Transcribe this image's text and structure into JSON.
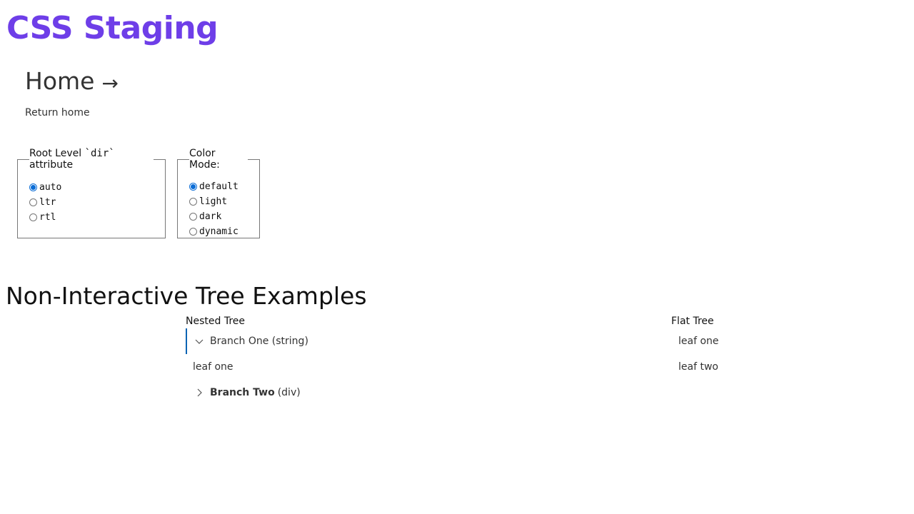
{
  "app": {
    "title": "CSS Staging"
  },
  "nav": {
    "home_label": "Home",
    "home_arrow": "→",
    "return_home": "Return home"
  },
  "dir_fieldset": {
    "legend_prefix": "Root Level ",
    "legend_code": "`dir`",
    "legend_suffix": " attribute",
    "options": [
      "auto",
      "ltr",
      "rtl"
    ],
    "selected": "auto"
  },
  "color_fieldset": {
    "legend": "Color Mode:",
    "options": [
      "default",
      "light",
      "dark",
      "dynamic"
    ],
    "selected": "default"
  },
  "section": {
    "title": "Non-Interactive Tree Examples"
  },
  "nested_tree": {
    "heading": "Nested Tree",
    "branch_one_label": "Branch One (string)",
    "leaf_one": "leaf one",
    "branch_two_bold": "Branch Two",
    "branch_two_suffix": "(div)"
  },
  "flat_tree": {
    "heading": "Flat Tree",
    "leaves": [
      "leaf one",
      "leaf two"
    ]
  },
  "colors": {
    "accent": "#6e3ee8",
    "radio_checked": "#0a6cd6",
    "tree_indicator": "#0a64b4"
  },
  "icons": {
    "home_arrow": "right-arrow-icon",
    "branch_expanded": "chevron-down-icon",
    "branch_collapsed": "chevron-right-icon"
  }
}
